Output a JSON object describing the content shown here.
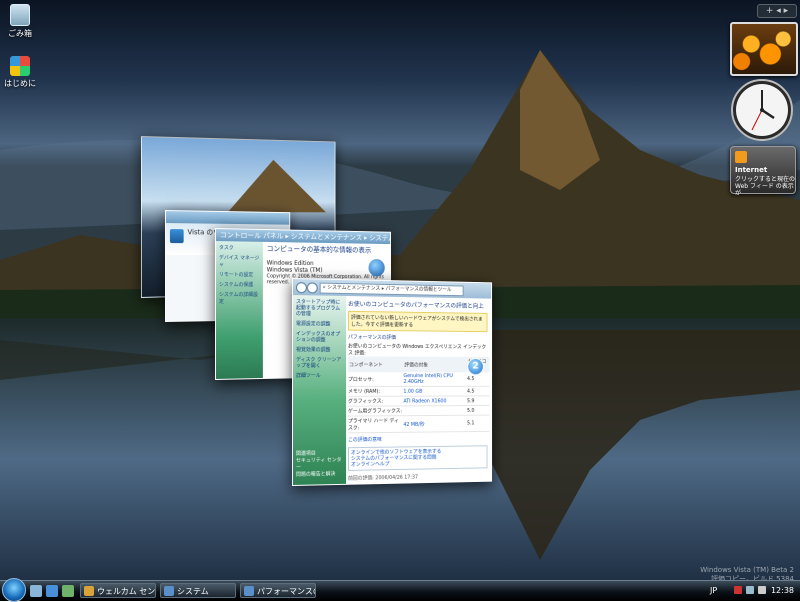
{
  "desktop": {
    "icons": [
      {
        "label": "ごみ箱"
      },
      {
        "label": "はじめに"
      }
    ]
  },
  "sidebar": {
    "controls": "+ ◂ ▸",
    "feed": {
      "title": "Internet",
      "body": "クリックすると現在の Web フィード の表示が"
    }
  },
  "windows": {
    "system": {
      "title": "コントロール パネル ▸ システムとメンテナンス ▸ システム",
      "heading": "コンピュータの基本的な情報の表示",
      "nav": [
        "タスク",
        "デバイス マネージャ",
        "リモートの設定",
        "システムの保護",
        "システムの詳細設定"
      ],
      "edition": "Windows Edition",
      "lines": [
        "Windows Vista (TM)",
        "Copyright © 2006 Microsoft Corporation. All rights reserved."
      ]
    },
    "welcome": {
      "heading": "Vista のウェルカム センター"
    },
    "performance": {
      "address": "« システムとメンテナンス ▸ パフォーマンスの情報とツール",
      "nav": [
        "スタートアップ時に起動するプログラムの管理",
        "電源設定の調整",
        "インデックスのオプションの調整",
        "視覚効果の調整",
        "ディスク クリーンアップを開く",
        "詳細ツール"
      ],
      "nav_footer": [
        "関連項目",
        "セキュリティ センター",
        "問題の報告と解決"
      ],
      "heading": "お使いのコンピュータのパフォーマンスの評価と向上",
      "notice": "評価されていない新しいハードウェアがシステムで検出されました。今すぐ評価を更新する",
      "section": "パフォーマンスの評価",
      "score_intro": "お使いのコンピュータの Windows エクスペリエンス インデックス 評価:",
      "table_headers": [
        "コンポーネント",
        "評価の対象",
        "サブスコア",
        "基本スコア"
      ],
      "rows": [
        {
          "component": "プロセッサ:",
          "detail": "Genuine Intel(R) CPU 2.40GHz",
          "sub": "4.5"
        },
        {
          "component": "メモリ (RAM):",
          "detail": "1.00 GB",
          "sub": "4.5"
        },
        {
          "component": "グラフィックス:",
          "detail": "ATI Radeon X1600",
          "sub": "5.9"
        },
        {
          "component": "ゲーム用グラフィックス:",
          "detail": "",
          "sub": "5.0"
        },
        {
          "component": "プライマリ ハード ディスク:",
          "detail": "42 MB/秒",
          "sub": "5.1"
        }
      ],
      "base_score": "2",
      "more_link": "この評価の意味",
      "box_lines": [
        "オンラインで他のソフトウェアを表示する",
        "システムのパフォーマンスに関する問題",
        "オンラインヘルプ"
      ],
      "date": "前回の評価: 2006/04/26 17:37"
    }
  },
  "taskbar": {
    "buttons": [
      {
        "label": "ウェルカム センター"
      },
      {
        "label": "システム"
      },
      {
        "label": "パフォーマンスの..."
      }
    ],
    "lang": "JP",
    "clock": "12:38",
    "watermark": [
      "Windows Vista (TM) Beta 2",
      "評価コピー。ビルド 5384"
    ]
  }
}
